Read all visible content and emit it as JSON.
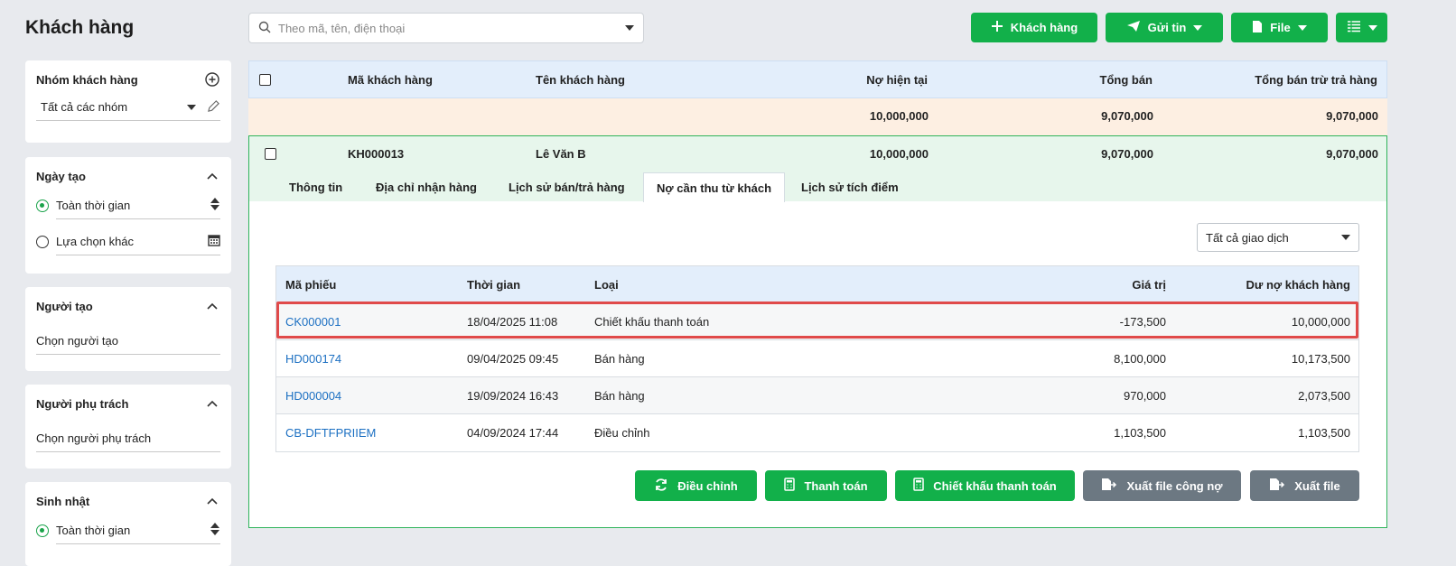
{
  "page": {
    "title": "Khách hàng"
  },
  "search": {
    "placeholder": "Theo mã, tên, điện thoại"
  },
  "toolbar": {
    "add_customer": "Khách hàng",
    "send_message": "Gửi tin",
    "file": "File"
  },
  "sidebar": {
    "group": {
      "title": "Nhóm khách hàng",
      "value": "Tất cả các nhóm"
    },
    "created_date": {
      "title": "Ngày tạo",
      "opt_all": "Toàn thời gian",
      "opt_other": "Lựa chọn khác"
    },
    "creator": {
      "title": "Người tạo",
      "placeholder": "Chọn người tạo"
    },
    "owner": {
      "title": "Người phụ trách",
      "placeholder": "Chọn người phụ trách"
    },
    "birthday": {
      "title": "Sinh nhật",
      "opt_all": "Toàn thời gian"
    }
  },
  "table": {
    "headers": {
      "code": "Mã khách hàng",
      "name": "Tên khách hàng",
      "debt": "Nợ hiện tại",
      "total_sales": "Tổng bán",
      "net_sales": "Tổng bán trừ trả hàng"
    },
    "summary": {
      "debt": "10,000,000",
      "total_sales": "9,070,000",
      "net_sales": "9,070,000"
    },
    "customer": {
      "code": "KH000013",
      "name": "Lê Văn B",
      "debt": "10,000,000",
      "total_sales": "9,070,000",
      "net_sales": "9,070,000"
    }
  },
  "detail": {
    "tabs": [
      "Thông tin",
      "Địa chỉ nhận hàng",
      "Lịch sử bán/trả hàng",
      "Nợ cần thu từ khách",
      "Lịch sử tích điểm"
    ],
    "filter": "Tất cả giao dịch",
    "headers": {
      "code": "Mã phiếu",
      "time": "Thời gian",
      "type": "Loại",
      "value": "Giá trị",
      "balance": "Dư nợ khách hàng"
    },
    "rows": [
      {
        "code": "CK000001",
        "time": "18/04/2025 11:08",
        "type": "Chiết khấu thanh toán",
        "value": "-173,500",
        "balance": "10,000,000"
      },
      {
        "code": "HD000174",
        "time": "09/04/2025 09:45",
        "type": "Bán hàng",
        "value": "8,100,000",
        "balance": "10,173,500"
      },
      {
        "code": "HD000004",
        "time": "19/09/2024 16:43",
        "type": "Bán hàng",
        "value": "970,000",
        "balance": "2,073,500"
      },
      {
        "code": "CB-DFTFPRIIEM",
        "time": "04/09/2024 17:44",
        "type": "Điều chỉnh",
        "value": "1,103,500",
        "balance": "1,103,500"
      }
    ],
    "actions": {
      "adjust": "Điều chỉnh",
      "pay": "Thanh toán",
      "discount": "Chiết khấu thanh toán",
      "export_debt": "Xuất file công nợ",
      "export": "Xuất file"
    }
  },
  "colors": {
    "green": "#12b04a",
    "gray": "#6c7882",
    "link": "#1b6fc2",
    "highlight": "#e04a4a"
  }
}
